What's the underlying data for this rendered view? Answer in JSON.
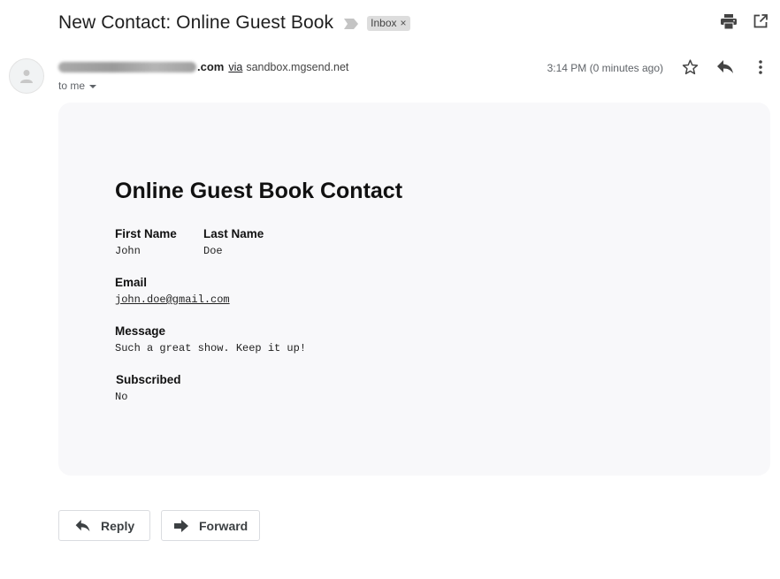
{
  "email": {
    "subject": "New Contact: Online Guest Book",
    "label": "Inbox",
    "label_remove": "×",
    "sender_domain": ".com",
    "via": "via",
    "via_domain": "sandbox.mgsend.net",
    "recipient": "to me",
    "timestamp": "3:14 PM (0 minutes ago)"
  },
  "card": {
    "title": "Online Guest Book Contact",
    "fields": {
      "first_name_label": "First Name",
      "first_name_value": "John",
      "last_name_label": "Last Name",
      "last_name_value": "Doe",
      "email_label": "Email",
      "email_value": "john.doe@gmail.com",
      "message_label": "Message",
      "message_value": "Such a great show. Keep it up!",
      "subscribed_label": "Subscribed",
      "subscribed_value": "No"
    }
  },
  "actions": {
    "reply_label": "Reply",
    "forward_label": "Forward"
  },
  "icons": {
    "importance": "importance-marker-icon",
    "print": "print-icon",
    "new_window": "open-in-new-window-icon",
    "avatar": "avatar-person-icon",
    "star": "star-icon",
    "reply": "reply-icon",
    "more": "more-vertical-icon",
    "forward": "forward-icon"
  }
}
